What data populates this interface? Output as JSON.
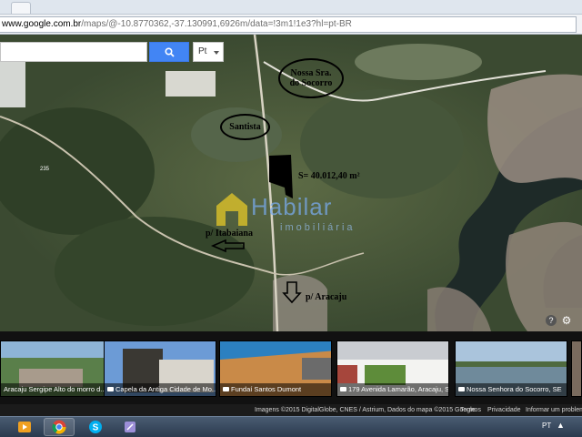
{
  "browser": {
    "url_host": "www.google.com.br",
    "url_path": "/maps/@-10.8770362,-37.130991,6926m/data=!3m1!1e3?hl=pt-BR"
  },
  "map": {
    "search": {
      "placeholder": "",
      "value": ""
    },
    "search_icon": "search-icon",
    "language_select": {
      "selected": "Pt"
    },
    "annotations": {
      "socorro_line1": "Nossa Sra.",
      "socorro_line2": "do Socorro",
      "santista": "Santista",
      "area": "S= 40.012,40 m²",
      "itabaiana": "p/ Itabaiana",
      "aracaju": "p/ Aracaju"
    },
    "watermark": {
      "title": "Habilar",
      "subtitle": "imobiliária"
    },
    "road_label": "235",
    "controls": {
      "help": "?",
      "settings_icon": "gear-icon"
    }
  },
  "photos": [
    {
      "caption": "Aracaju Sergipe Alto do morro d..."
    },
    {
      "caption": "Capela da Antiga Cidade de Mo..."
    },
    {
      "caption": "Fundaí Santos Dumont"
    },
    {
      "caption": "179 Avenida Lamarão, Aracaju, SE"
    },
    {
      "caption": "Nossa Senhora do Socorro, SE"
    }
  ],
  "attribution": {
    "imagery": "Imagens ©2015 DigitalGlobe, CNES / Astrium, Dados do mapa ©2015 Google",
    "terms": "Termos",
    "privacy": "Privacidade",
    "report": "Informar um problema"
  },
  "taskbar": {
    "language": "PT",
    "apps": [
      "media-player-icon",
      "chrome-icon",
      "skype-icon",
      "app-icon"
    ]
  },
  "colors": {
    "search_blue": "#4285f4",
    "annotation_black": "#000000",
    "taskbar": "#2a3a4e"
  }
}
